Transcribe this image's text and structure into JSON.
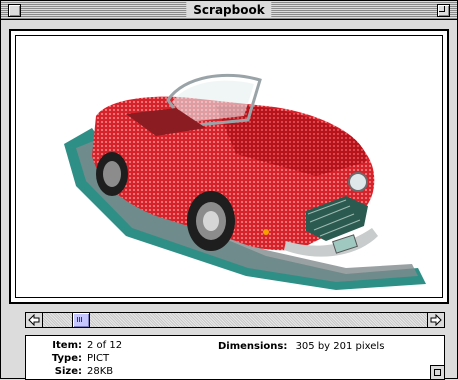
{
  "window": {
    "title": "Scrapbook"
  },
  "item": {
    "item_label": "Item:",
    "item_value": "2 of 12",
    "type_label": "Type:",
    "type_value": "PICT",
    "size_label": "Size:",
    "size_value": "28KB",
    "dimensions_label": "Dimensions:",
    "dimensions_value": "305 by 201 pixels"
  },
  "scroll": {
    "position": 2,
    "total": 12
  },
  "colors": {
    "car_body": "#e0343a",
    "shadow": "#2e8f86"
  }
}
